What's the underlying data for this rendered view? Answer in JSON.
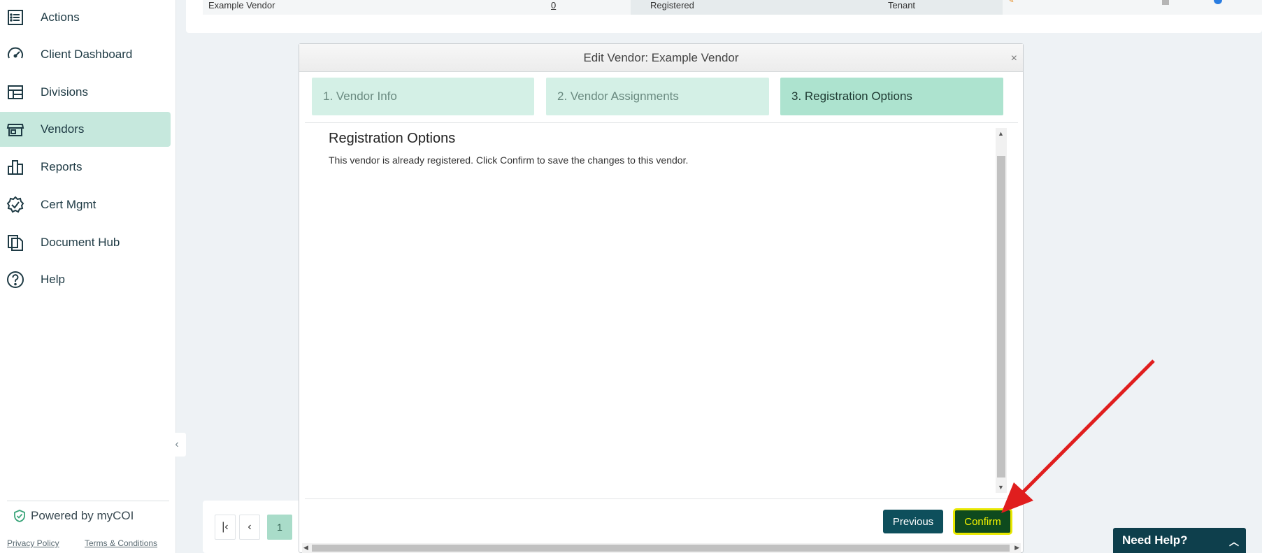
{
  "sidebar": {
    "items": [
      {
        "label": "Actions",
        "icon": "actions-list-icon"
      },
      {
        "label": "Client Dashboard",
        "icon": "speedometer-icon"
      },
      {
        "label": "Divisions",
        "icon": "layout-grid-icon"
      },
      {
        "label": "Vendors",
        "icon": "storefront-icon",
        "active": true
      },
      {
        "label": "Reports",
        "icon": "bar-chart-icon"
      },
      {
        "label": "Cert Mgmt",
        "icon": "verified-badge-icon"
      },
      {
        "label": "Document Hub",
        "icon": "documents-icon"
      },
      {
        "label": "Help",
        "icon": "help-circle-icon"
      }
    ],
    "powered_by": "Powered by myCOI",
    "privacy_policy": "Privacy Policy",
    "terms": "Terms & Conditions"
  },
  "background_table": {
    "row": {
      "vendor": "Example Vendor",
      "count": "0",
      "status": "Registered",
      "type": "Tenant"
    }
  },
  "pagination": {
    "current_page": "1"
  },
  "modal": {
    "title": "Edit Vendor: Example Vendor",
    "close": "×",
    "steps": [
      {
        "label": "1. Vendor Info",
        "state": "inactive"
      },
      {
        "label": "2. Vendor Assignments",
        "state": "inactive"
      },
      {
        "label": "3. Registration Options",
        "state": "current"
      }
    ],
    "section_title": "Registration Options",
    "section_text": "This vendor is already registered. Click Confirm to save the changes to this vendor.",
    "previous_label": "Previous",
    "confirm_label": "Confirm"
  },
  "need_help": {
    "label": "Need Help?"
  },
  "colors": {
    "active_nav": "#c6e8dd",
    "step_inactive": "#d4f0e6",
    "step_current": "#ade3cf",
    "primary_button": "#0e4f5c",
    "confirm_highlight": "#e8e800",
    "annotation_arrow": "#e01e1e"
  }
}
